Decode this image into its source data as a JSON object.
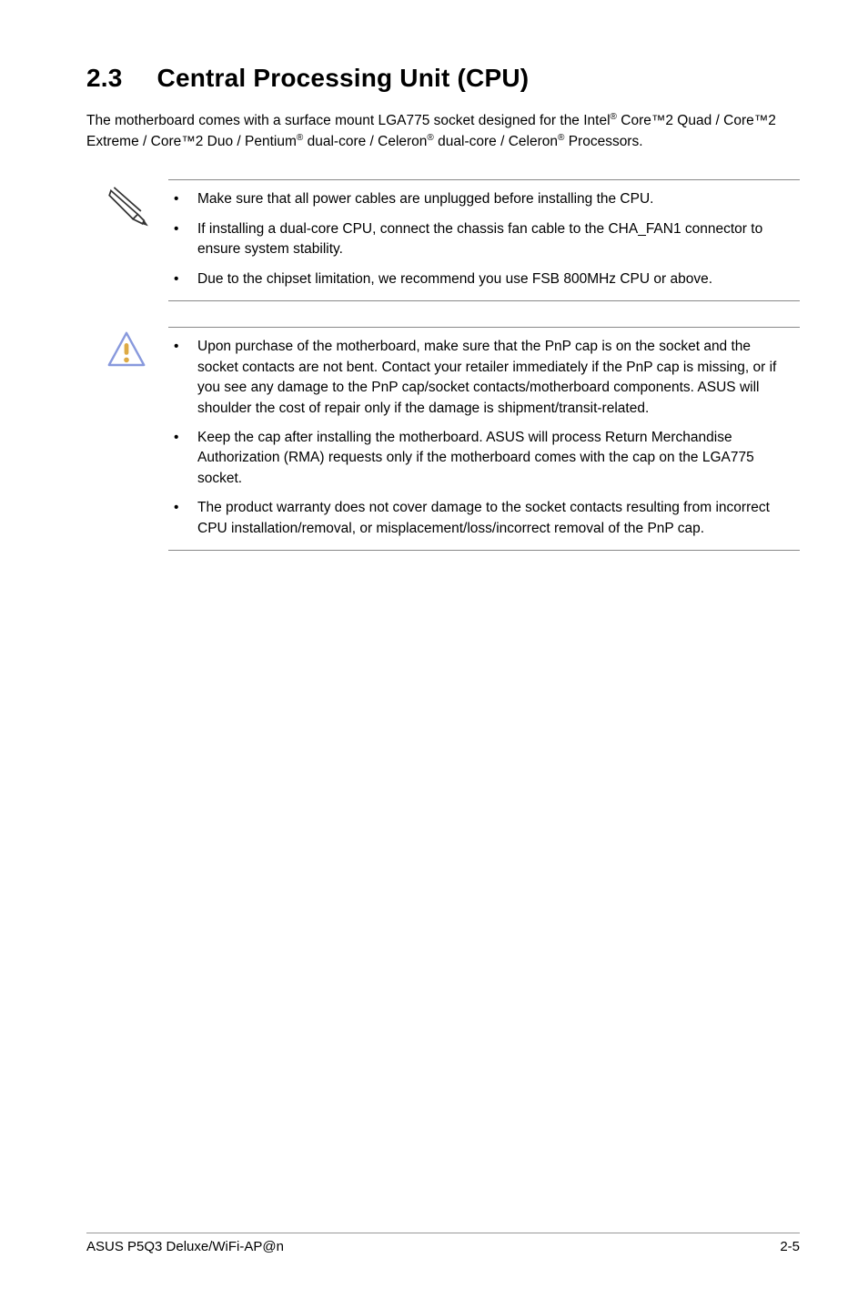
{
  "heading": {
    "number": "2.3",
    "title": "Central Processing Unit (CPU)"
  },
  "intro": {
    "line1_pre": "The motherboard comes with a surface mount LGA775 socket designed for the Intel",
    "line1_sup1": "®",
    "line1_mid1": " Core™2 Quad / Core™2 Extreme / Core™2 Duo / Pentium",
    "line1_sup2": "®",
    "line1_mid2": " dual-core / Celeron",
    "line1_sup3": "®",
    "line1_mid3": " dual-core / Celeron",
    "line1_sup4": "®",
    "line1_end": " Processors."
  },
  "notes1": {
    "item1": "Make sure that all power cables are unplugged before installing the CPU.",
    "item2": "If installing a dual-core CPU, connect the chassis fan cable to the CHA_FAN1 connector to ensure system stability.",
    "item3": "Due to the chipset limitation, we recommend you use FSB 800MHz CPU or above."
  },
  "notes2": {
    "item1": "Upon purchase of the motherboard, make sure that the PnP cap is on the socket and the socket contacts are not bent. Contact your retailer immediately if the PnP cap is missing, or if you see any damage to the PnP cap/socket contacts/motherboard components. ASUS will shoulder the cost of repair only if the damage is shipment/transit-related.",
    "item2": "Keep the cap after installing the motherboard. ASUS will process Return Merchandise Authorization (RMA) requests only if the motherboard comes with the cap on the LGA775 socket.",
    "item3": "The product warranty does not cover damage to the socket contacts resulting from incorrect CPU installation/removal, or misplacement/loss/incorrect removal of the PnP cap."
  },
  "footer": {
    "left": "ASUS P5Q3 Deluxe/WiFi-AP@n",
    "right": "2-5"
  }
}
